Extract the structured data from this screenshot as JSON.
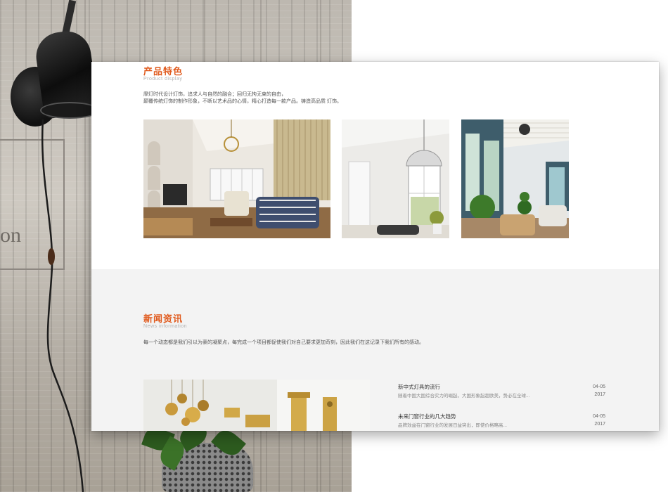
{
  "background": {
    "frame_text": "on"
  },
  "features": {
    "title": "产品特色",
    "subtitle": "Product display",
    "description_lines": [
      "摩灯时代设计灯饰，追求人与自然的融合；回归无拘无束的自由，",
      "颠覆传统灯饰的制作形象，不断以艺术品的心情，精心打造每一款产品。铸造高品质 灯饰。"
    ]
  },
  "news": {
    "title": "新闻资讯",
    "subtitle": "News information",
    "description": "每一个动态都是我们引以为豪的凝聚点，每完成一个项目都促使我们对自己要求更加苛刻，因此我们在这记录下我们所有的感动。",
    "items": [
      {
        "title": "新中式灯具的流行",
        "summary": "随着中国大国综合实力的崛起，大国形象起超欧美，势必在全球...",
        "date_day": "04-05",
        "date_year": "2017"
      },
      {
        "title": "未来门窗行业的几大趋势",
        "summary": "品牌效益在门窗行业的发展日益突出，即使价格略高...",
        "date_day": "04-05",
        "date_year": "2017"
      }
    ]
  },
  "colors": {
    "accent": "#e05a1d",
    "news_bg": "#f3f3f3"
  }
}
